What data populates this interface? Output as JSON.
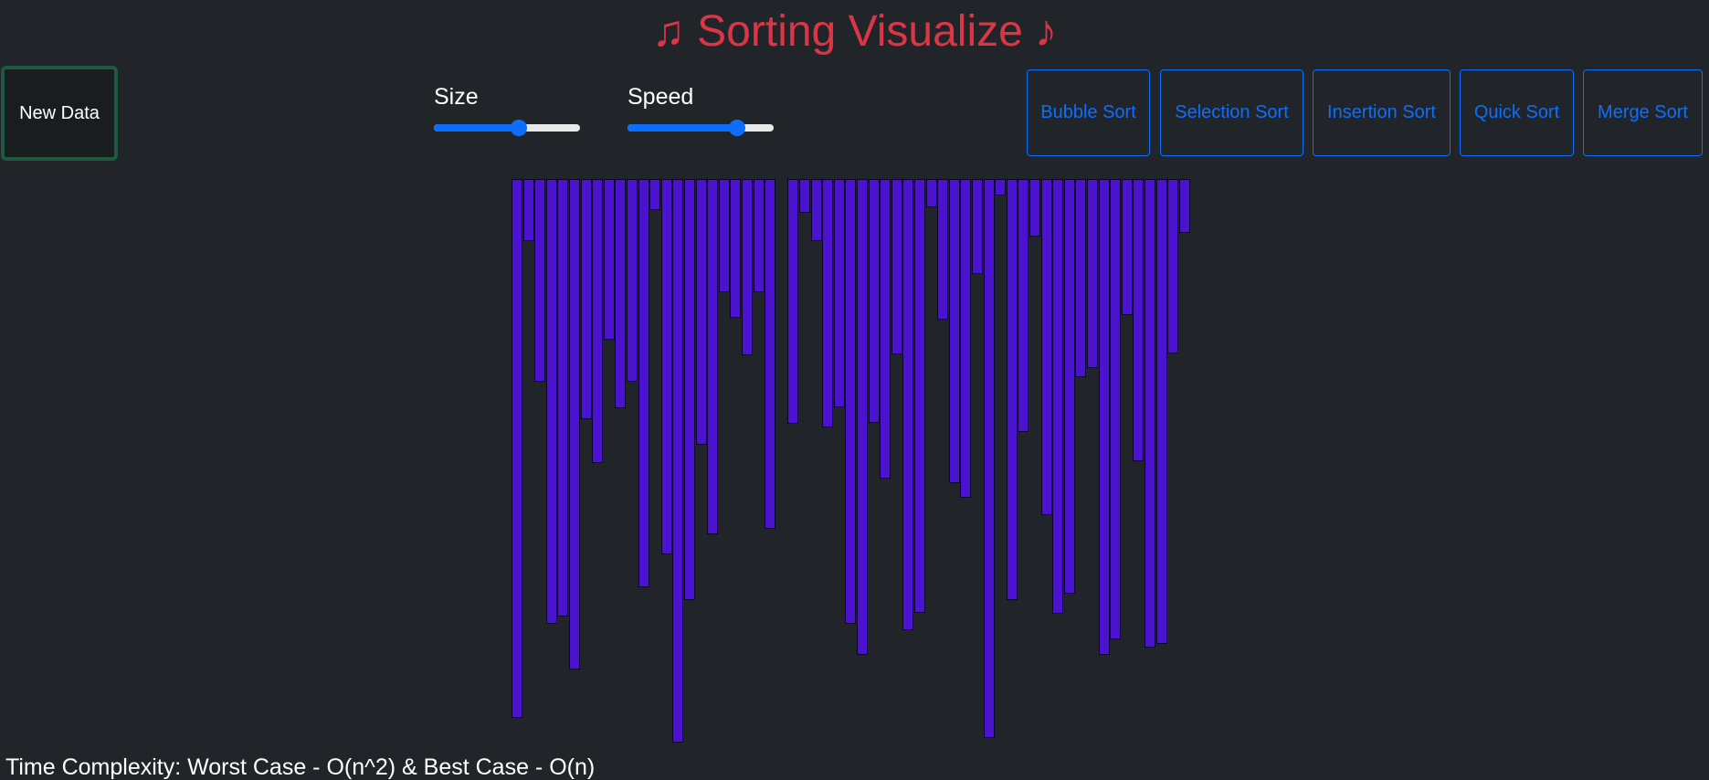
{
  "header": {
    "title": "♫ Sorting Visualize ♪"
  },
  "toolbar": {
    "new_data_label": "New Data",
    "size": {
      "label": "Size",
      "value": 0.58
    },
    "speed": {
      "label": "Speed",
      "value": 0.75
    },
    "algorithms": [
      "Bubble Sort",
      "Selection Sort",
      "Insertion Sort",
      "Quick Sort",
      "Merge Sort"
    ]
  },
  "chart_data": {
    "type": "bar",
    "title": "",
    "orientation": "hanging-from-top",
    "color": "#4b12d0",
    "border_color": "#0b0530",
    "ylim": [
      0,
      620
    ],
    "values": [
      590,
      68,
      222,
      487,
      479,
      537,
      263,
      311,
      176,
      251,
      222,
      447,
      34,
      411,
      617,
      461,
      291,
      389,
      124,
      152,
      193,
      124,
      383,
      0,
      268,
      37,
      68,
      272,
      250,
      487,
      521,
      267,
      328,
      192,
      494,
      475,
      31,
      154,
      333,
      349,
      104,
      612,
      18,
      461,
      277,
      63,
      368,
      476,
      454,
      217,
      207,
      521,
      504,
      149,
      309,
      513,
      509,
      191,
      59
    ]
  },
  "footer": {
    "complexity": "Time Complexity: Worst Case - O(n^2) & Best Case - O(n)"
  }
}
